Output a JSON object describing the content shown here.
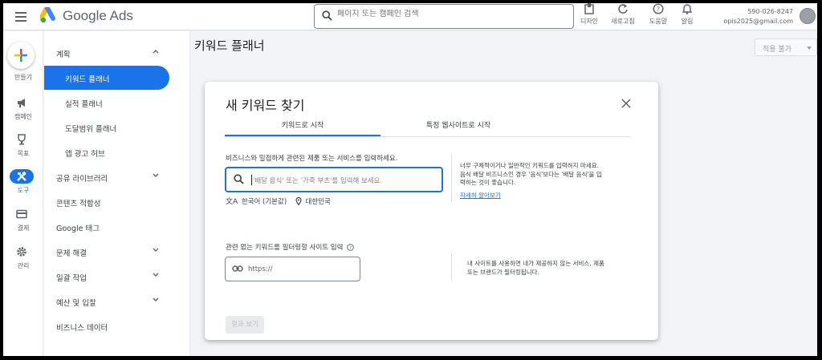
{
  "header": {
    "brand": "Google Ads",
    "search_placeholder": "페이지 또는 캠페인 검색",
    "tools": [
      {
        "label": "디자인",
        "icon": "design-icon"
      },
      {
        "label": "새로고침",
        "icon": "refresh-icon"
      },
      {
        "label": "도움말",
        "icon": "help-icon"
      },
      {
        "label": "알림",
        "icon": "bell-icon"
      }
    ],
    "account_id": "590-026-8247",
    "account_email": "opis2025@gmail.com"
  },
  "rail": {
    "create_label": "만들기",
    "items": [
      {
        "label": "캠페인",
        "icon": "megaphone-icon"
      },
      {
        "label": "목표",
        "icon": "trophy-icon"
      },
      {
        "label": "도구",
        "icon": "tools-icon",
        "active": true
      },
      {
        "label": "결제",
        "icon": "credit-card-icon"
      },
      {
        "label": "관리",
        "icon": "gear-icon"
      }
    ]
  },
  "sidebar": {
    "items": [
      {
        "label": "계획",
        "chevron": "up"
      },
      {
        "label": "키워드 플래너",
        "active": true
      },
      {
        "label": "실적 플래너"
      },
      {
        "label": "도달범위 플래너"
      },
      {
        "label": "앱 광고 허브"
      },
      {
        "label": "공유 라이브러리",
        "chevron": "down"
      },
      {
        "label": "콘텐츠 적합성"
      },
      {
        "label": "Google 태그"
      },
      {
        "label": "문제 해결",
        "chevron": "down"
      },
      {
        "label": "일괄 작업",
        "chevron": "down"
      },
      {
        "label": "예산 및 입찰",
        "chevron": "down"
      },
      {
        "label": "비즈니스 데이터"
      }
    ]
  },
  "main": {
    "title": "키워드 플래너",
    "status_select": "적용 불가"
  },
  "dialog": {
    "title": "새 키워드 찾기",
    "tabs": [
      {
        "label": "키워드로 시작",
        "selected": true
      },
      {
        "label": "특정 웹사이트로 시작",
        "selected": false
      }
    ],
    "keyword_label": "비즈니스와 밀접하게 관련된 제품 또는 서비스를 입력하세요.",
    "keyword_placeholder": "'배달 음식' 또는 '가죽 부츠'를 입력해 보세요.",
    "language": "한국어 (기본값)",
    "location": "대한민국",
    "tip_lines": [
      "너무 구체적이거나 일반적인 키워드를 입력하지 마세요.",
      "음식 배달 비즈니스인 경우 '음식'보다는 '배달 음식'을 입",
      "력하는 것이 좋습니다."
    ],
    "learn_more": "자세히 알아보기",
    "site_label": "관련 없는 키워드를 필터링할 사이트 입력",
    "site_value": "https://",
    "site_tip_lines": [
      "내 사이트를 사용하면 내가 제공하지 않는 서비스, 제품",
      "또는 브랜드가 필터링됩니다."
    ],
    "results_button": "결과 보기"
  },
  "colors": {
    "accent": "#1a73e8",
    "text": "#3c4043",
    "background": "#f1f3f4"
  }
}
